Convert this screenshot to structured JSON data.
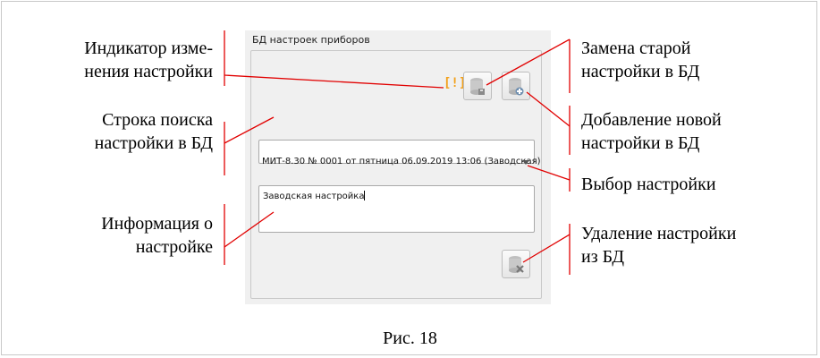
{
  "panel": {
    "title": "БД настроек приборов",
    "indicator": "[!]",
    "search": {
      "value": "",
      "placeholder": ""
    },
    "selected_setting": "МИТ-8.30 № 0001 от пятница 06.09.2019 13:06 (Заводская)",
    "info_text": "Заводская настройка"
  },
  "annotations": {
    "indicator": [
      "Индикатор изме-",
      "нения настройки"
    ],
    "search": [
      "Строка поиска",
      "настройки в БД"
    ],
    "info": [
      "Информация о",
      "настройке"
    ],
    "replace": [
      "Замена старой",
      "настройки в БД"
    ],
    "add": [
      "Добавление новой",
      "настройки в БД"
    ],
    "select": "Выбор настройки",
    "delete": [
      "Удаление настройки",
      "из БД"
    ]
  },
  "caption": "Рис. 18",
  "icons": {
    "replace": "db-save-icon",
    "add": "db-add-icon",
    "delete": "db-delete-icon"
  },
  "colors": {
    "annotation_line": "#e10000",
    "indicator": "#f2a01b",
    "panel": "#f0f0f0"
  }
}
